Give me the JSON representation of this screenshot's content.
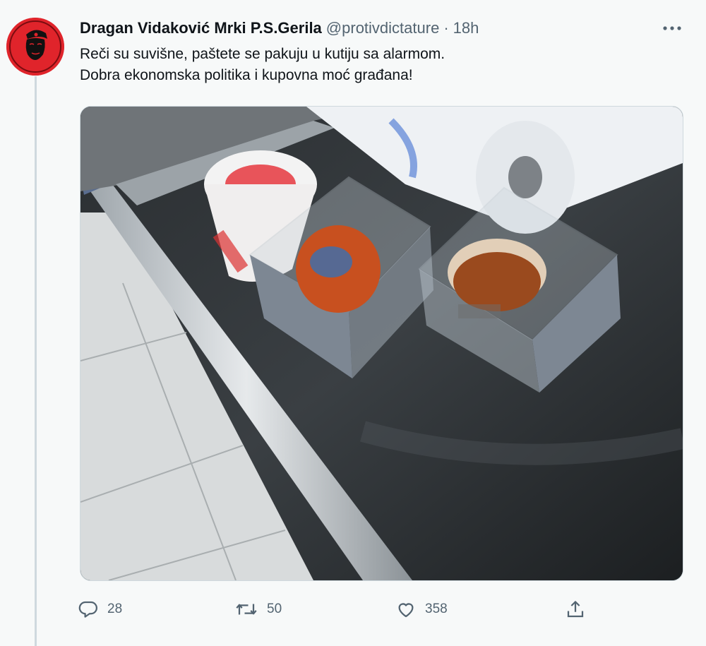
{
  "tweet": {
    "display_name": "Dragan Vidaković Mrki P.S.Gerila",
    "handle": "@protivdictature",
    "separator": "·",
    "timestamp": "18h",
    "text_line1": "Reči su suvišne, paštete se pakuju u kutiju sa alarmom.",
    "text_line2": "Dobra ekonomska politika i kupovna moć građana!",
    "avatar_icon": "che-guevara-logo-icon",
    "media_alt": "photo",
    "more_icon": "more-horizontal-icon"
  },
  "actions": {
    "reply": {
      "icon": "reply-icon",
      "count": "28"
    },
    "retweet": {
      "icon": "retweet-icon",
      "count": "50"
    },
    "like": {
      "icon": "heart-icon",
      "count": "358"
    },
    "share": {
      "icon": "share-icon"
    }
  },
  "colors": {
    "text": "#0f1419",
    "secondary": "#536471",
    "border": "#cfd9de",
    "avatar_bg": "#e0242b",
    "background": "#f7f9f9"
  }
}
